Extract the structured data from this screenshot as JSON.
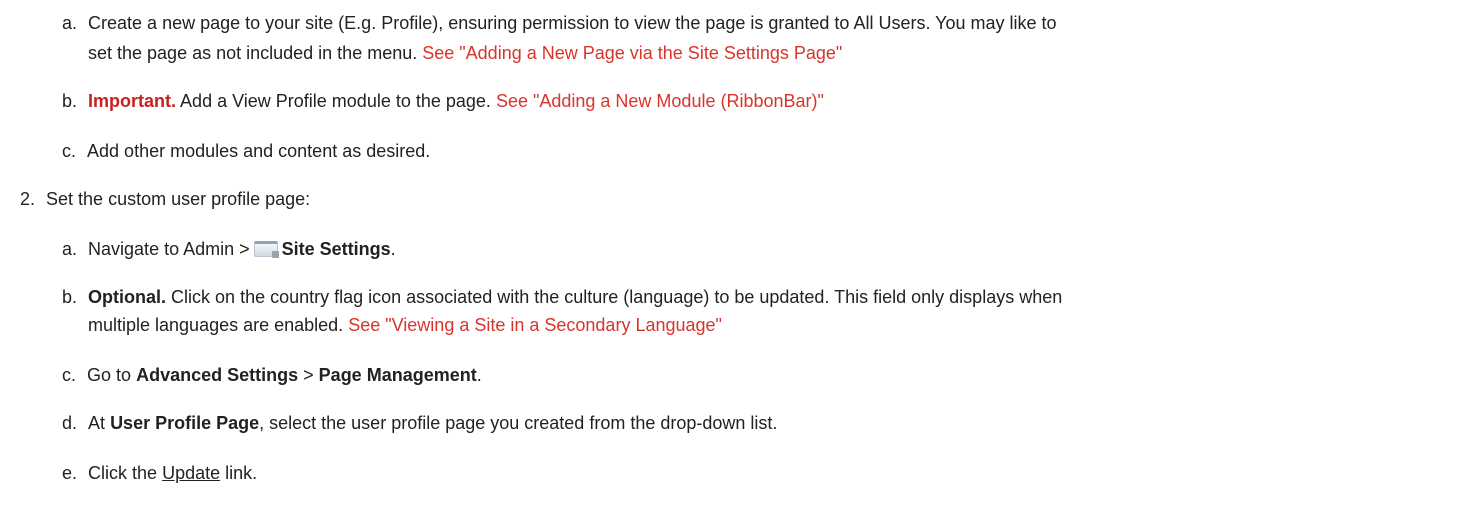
{
  "step1": {
    "a": {
      "marker": "a.",
      "text_l1": "Create a new page to your site (E.g. Profile), ensuring permission to view the page is granted to All Users. You may like to",
      "text_l2": "set the page as not included in the menu.",
      "link": "See \"Adding a New Page via the Site Settings Page\""
    },
    "b": {
      "marker": "b.",
      "important": "Important.",
      "text": "Add a View Profile module to the page.",
      "link": "See \"Adding a New Module (RibbonBar)\""
    },
    "c": {
      "marker": "c.",
      "text": "Add other modules and content as desired."
    }
  },
  "step2": {
    "marker": "2.",
    "text": "Set the custom user profile page:",
    "a": {
      "marker": "a.",
      "pre": "Navigate to Admin >",
      "icon": "site-settings-icon",
      "bold": "Site Settings",
      "post": "."
    },
    "b": {
      "marker": "b.",
      "bold": "Optional.",
      "text_l1": "Click on the country flag icon associated with the culture (language) to be updated. This field only displays when",
      "text_l2": "multiple languages are enabled.",
      "link": "See \"Viewing a Site in a Secondary Language\""
    },
    "c": {
      "marker": "c.",
      "pre": "Go to",
      "bold1": "Advanced Settings",
      "sep": ">",
      "bold2": "Page Management",
      "post": "."
    },
    "d": {
      "marker": "d.",
      "pre": "At",
      "bold": "User Profile Page",
      "post": ", select the user profile page you created from the drop-down list."
    },
    "e": {
      "marker": "e.",
      "pre": "Click the",
      "link": "Update",
      "post": "link."
    }
  }
}
